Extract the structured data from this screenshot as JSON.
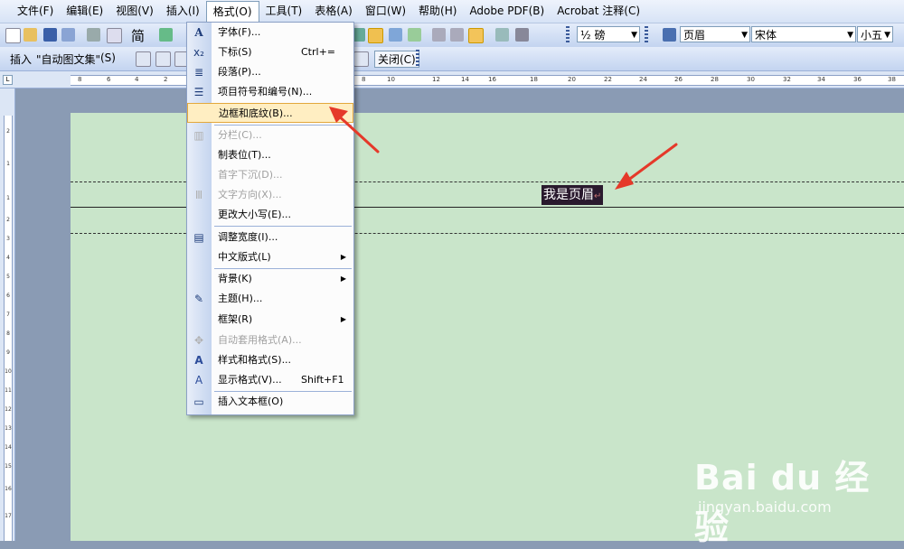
{
  "menubar": {
    "items": [
      "文件(F)",
      "编辑(E)",
      "视图(V)",
      "插入(I)",
      "格式(O)",
      "工具(T)",
      "表格(A)",
      "窗口(W)",
      "帮助(H)",
      "Adobe PDF(B)",
      "Acrobat 注释(C)"
    ],
    "active_index": 4
  },
  "toolbar1": {
    "line_weight": "½ 磅",
    "style": "页眉",
    "font": "宋体",
    "font_size": "小五",
    "simplified_label": "简"
  },
  "toolbar2": {
    "insert_label": "插入",
    "autotext_label": "\"自动图文集\"",
    "autotext_menu": "(S)",
    "close_label": "关闭(C)"
  },
  "ruler": {
    "h_ticks": [
      "8",
      "6",
      "4",
      "2",
      "2",
      "4",
      "8",
      "10",
      "12",
      "14",
      "16",
      "18",
      "20",
      "22",
      "24",
      "26",
      "28",
      "30",
      "32",
      "34",
      "36",
      "38"
    ],
    "v_ticks": [
      "2",
      "1",
      "1",
      "2",
      "3",
      "4",
      "5",
      "6",
      "7",
      "8",
      "9",
      "10",
      "11",
      "12",
      "13",
      "14",
      "15",
      "16",
      "17"
    ]
  },
  "page": {
    "header_text": "我是页眉",
    "para_mark": "↵"
  },
  "format_menu": {
    "items": [
      {
        "label": "字体(F)...",
        "shortcut": "",
        "icon": "A",
        "disabled": false
      },
      {
        "label": "下标(S)",
        "shortcut": "Ctrl+=",
        "icon": "x₂",
        "disabled": false
      },
      {
        "label": "段落(P)...",
        "shortcut": "",
        "icon": "≣",
        "disabled": false
      },
      {
        "label": "项目符号和编号(N)...",
        "shortcut": "",
        "icon": "☰",
        "disabled": false
      },
      {
        "label": "边框和底纹(B)...",
        "shortcut": "",
        "icon": "",
        "disabled": false
      },
      {
        "label": "分栏(C)...",
        "shortcut": "",
        "icon": "▥",
        "disabled": true
      },
      {
        "label": "制表位(T)...",
        "shortcut": "",
        "icon": "",
        "disabled": false
      },
      {
        "label": "首字下沉(D)...",
        "shortcut": "",
        "icon": "",
        "disabled": true
      },
      {
        "label": "文字方向(X)...",
        "shortcut": "",
        "icon": "Ⅲ",
        "disabled": true
      },
      {
        "label": "更改大小写(E)...",
        "shortcut": "",
        "icon": "",
        "disabled": false
      },
      {
        "label": "调整宽度(I)...",
        "shortcut": "",
        "icon": "▤",
        "disabled": false
      },
      {
        "label": "中文版式(L)",
        "shortcut": "",
        "icon": "",
        "disabled": false
      },
      {
        "label": "背景(K)",
        "shortcut": "",
        "icon": "",
        "disabled": false
      },
      {
        "label": "主题(H)...",
        "shortcut": "",
        "icon": "✎",
        "disabled": false
      },
      {
        "label": "框架(R)",
        "shortcut": "",
        "icon": "",
        "disabled": false
      },
      {
        "label": "自动套用格式(A)...",
        "shortcut": "",
        "icon": "✥",
        "disabled": true
      },
      {
        "label": "样式和格式(S)...",
        "shortcut": "",
        "icon": "A",
        "disabled": false
      },
      {
        "label": "显示格式(V)...",
        "shortcut": "Shift+F1",
        "icon": "A",
        "disabled": false
      },
      {
        "label": "插入文本框(O)",
        "shortcut": "",
        "icon": "▭",
        "disabled": false
      }
    ]
  },
  "watermark": {
    "brand": "Bai du 经验",
    "url": "jingyan.baidu.com"
  }
}
